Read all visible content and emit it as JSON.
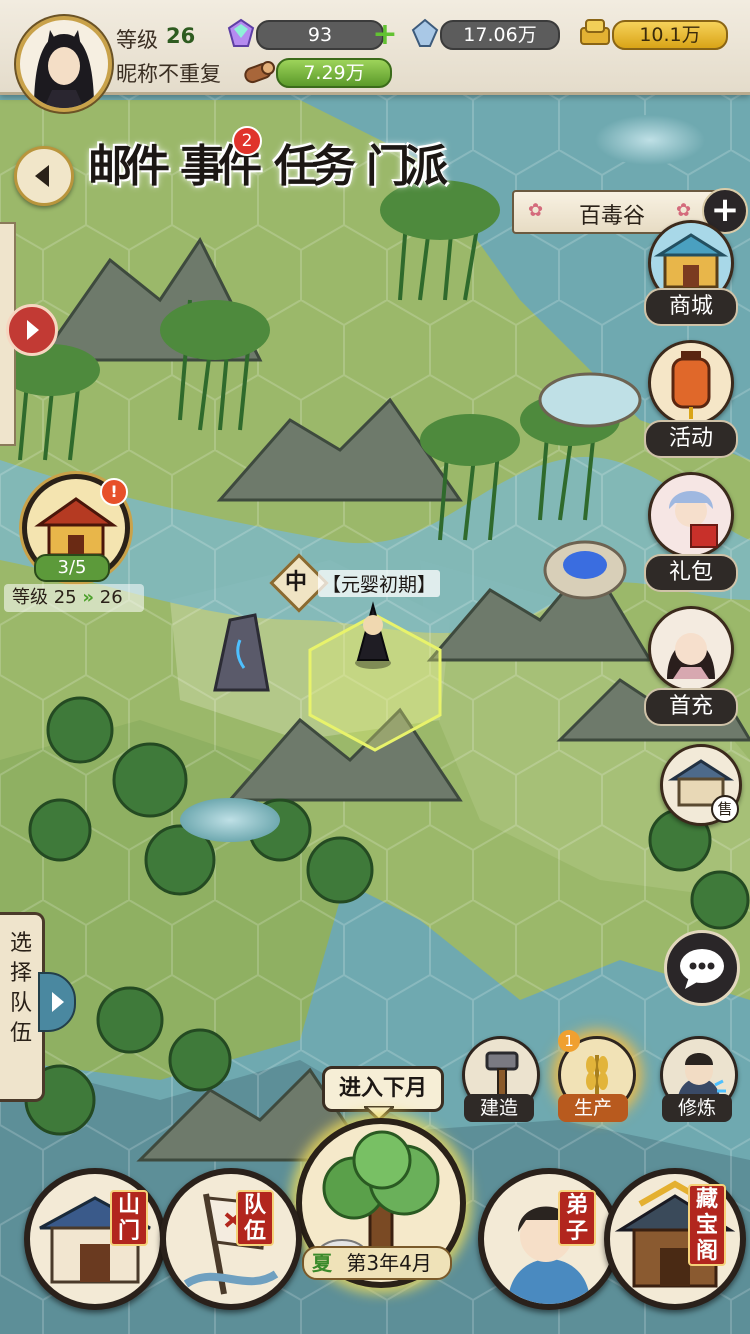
{
  "player": {
    "level_label": "等级",
    "level": "26",
    "nickname": "昵称不重复"
  },
  "resources": {
    "jade": "93",
    "crystal": "17.06万",
    "gold": "10.1万",
    "wood": "7.29万"
  },
  "tabs": [
    {
      "label": "邮件",
      "badge": ""
    },
    {
      "label": "事件",
      "badge": "2"
    },
    {
      "label": "任务",
      "badge": ""
    },
    {
      "label": "门派",
      "badge": ""
    }
  ],
  "location": {
    "name": "百毒谷"
  },
  "right_menu": [
    {
      "label": "商城",
      "icon": "shop-icon"
    },
    {
      "label": "活动",
      "icon": "lantern-icon"
    },
    {
      "label": "礼包",
      "icon": "gift-girl-icon"
    },
    {
      "label": "首充",
      "icon": "first-recharge-girl-icon"
    },
    {
      "label": "售",
      "icon": "store-icon"
    }
  ],
  "sect_building": {
    "progress": "3/5",
    "level_label": "等级",
    "level_from": "25",
    "level_to": "26",
    "alert": "!"
  },
  "map_unit": {
    "stage_badge": "中",
    "realm": "【元婴初期】"
  },
  "left_panel": {
    "select_team": "选择队伍"
  },
  "actions": [
    {
      "label": "建造",
      "icon": "hammer-icon",
      "badge": ""
    },
    {
      "label": "生产",
      "icon": "wheat-icon",
      "badge": "1"
    },
    {
      "label": "修炼",
      "icon": "cultivator-icon",
      "badge": ""
    }
  ],
  "next_month": {
    "button": "进入下月",
    "season": "夏",
    "date": "第3年4月"
  },
  "bottom_nav": [
    {
      "label": "山门",
      "icon": "sect-gate-icon"
    },
    {
      "label": "队伍",
      "icon": "banner-flag-icon"
    },
    {
      "label": "弟子",
      "icon": "disciple-icon"
    },
    {
      "label": "藏宝阁",
      "icon": "treasure-pavilion-icon"
    }
  ],
  "colors": {
    "water": "#6fa9b0",
    "grass": "#9bb86a",
    "accent_red": "#b2261e",
    "gold": "#d9a417"
  }
}
